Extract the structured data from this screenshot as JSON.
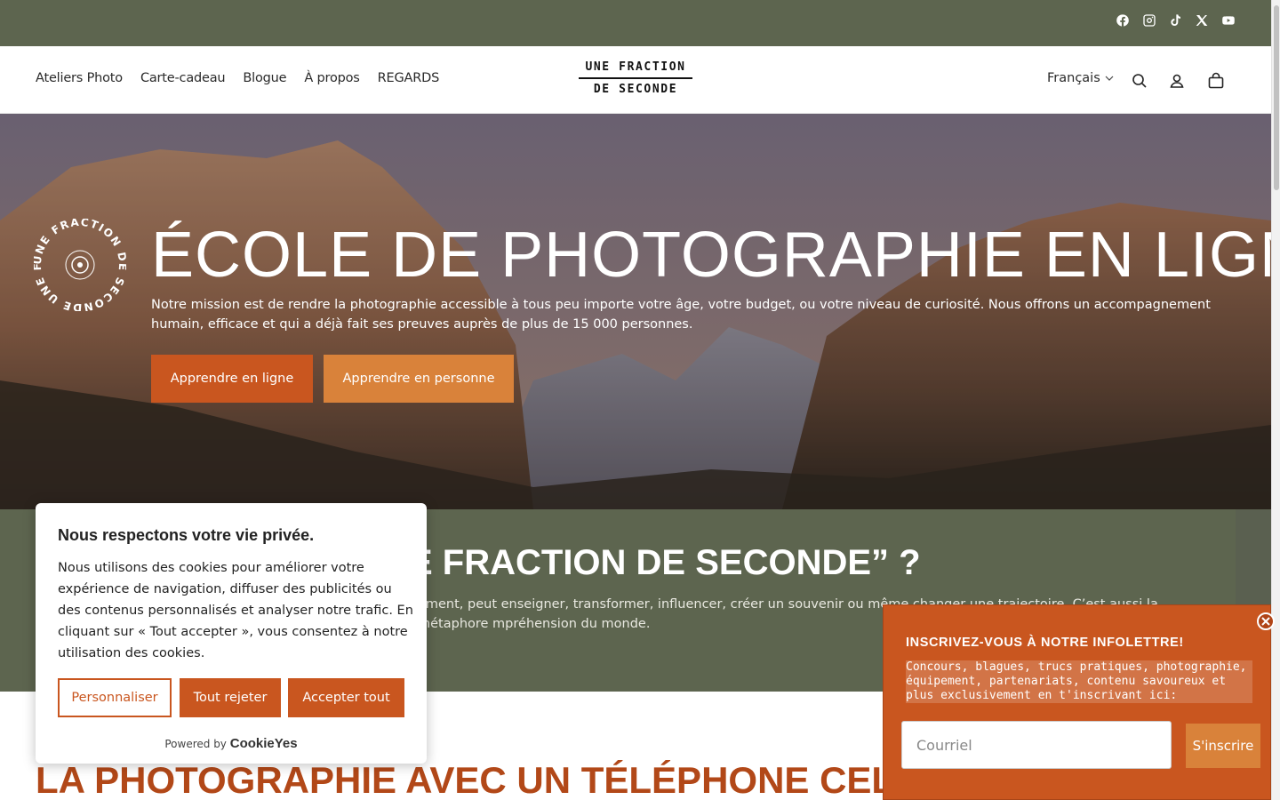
{
  "social": {
    "icons": [
      "facebook-icon",
      "instagram-icon",
      "tiktok-icon",
      "x-icon",
      "youtube-icon"
    ]
  },
  "header": {
    "nav": [
      "Ateliers Photo",
      "Carte-cadeau",
      "Blogue",
      "À propos",
      "REGARDS"
    ],
    "logo_line1": "UNE FRACTION",
    "logo_line2": "DE SECONDE",
    "language": "Français"
  },
  "hero": {
    "title": "ÉCOLE DE PHOTOGRAPHIE EN LIGNE",
    "text": "Notre mission est de rendre la photographie accessible à tous peu importe votre âge, votre budget, ou votre niveau de curiosité. Nous offrons un accompagnement humain, efficace et qui a déjà fait ses preuves auprès de plus de 15 000 personnes.",
    "btn_online": "Apprendre en ligne",
    "btn_person": "Apprendre en personne",
    "badge_text": "UNE FRACTION DE SECONDE UNE FRACTION DE SECONDE"
  },
  "about": {
    "title": "E FRACTION DE SECONDE” ?",
    "text": "oment, peut enseigner, transformer, influencer, créer un souvenir ou même changer une trajectoire. C’est aussi la métaphore mpréhension du monde."
  },
  "section": {
    "title": "LA PHOTOGRAPHIE AVEC UN TÉLÉPHONE CELLULA"
  },
  "cookie": {
    "title": "Nous respectons votre vie privée.",
    "text": "Nous utilisons des cookies pour améliorer votre expérience de navigation, diffuser des publicités ou des contenus personnalisés et analyser notre trafic. En cliquant sur « Tout accepter », vous consentez à notre utilisation des cookies.",
    "btn_customize": "Personnaliser",
    "btn_reject": "Tout rejeter",
    "btn_accept": "Accepter tout",
    "powered": "Powered by",
    "brand": "CookieYes"
  },
  "newsletter": {
    "title": "INSCRIVEZ-VOUS À NOTRE INFOLETTRE!",
    "desc": "Concours, blagues, trucs pratiques, photographie, équipement, partenariats, contenu savoureux et plus exclusivement en t'inscrivant ici:",
    "placeholder": "Courriel",
    "submit": "S'inscrire"
  },
  "colors": {
    "olive": "#5d654f",
    "orange": "#c9561f",
    "light_orange": "#d9823a",
    "title_orange": "#b24818"
  }
}
